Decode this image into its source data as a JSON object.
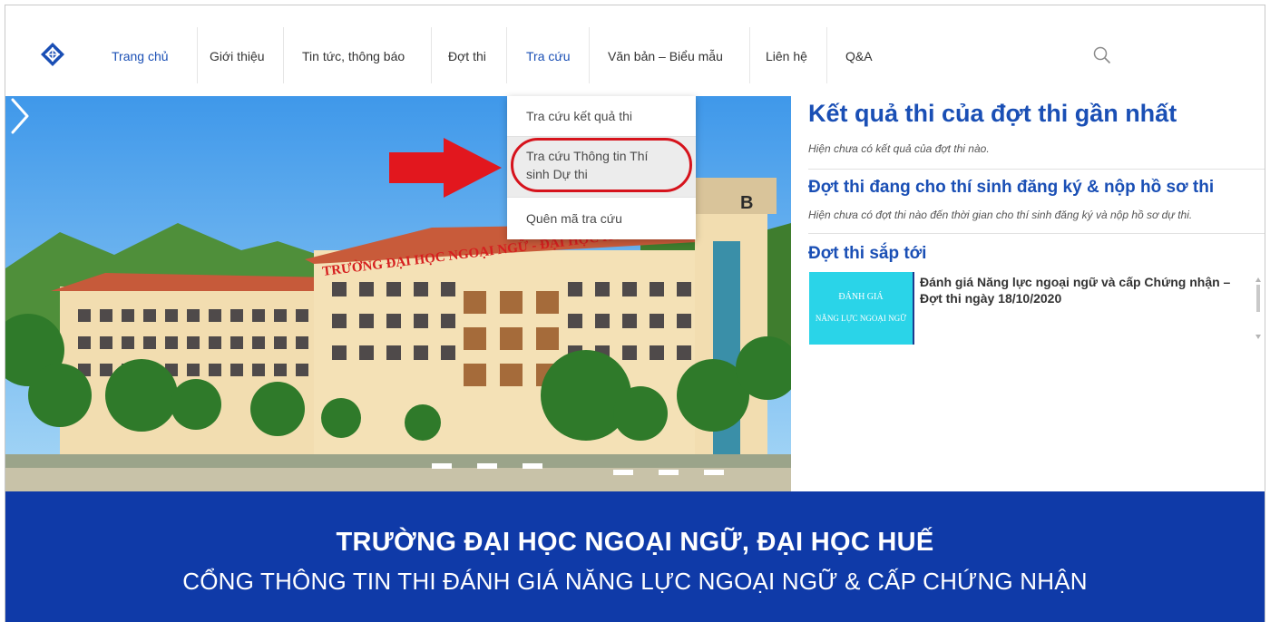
{
  "nav": {
    "items": [
      {
        "label": "Trang chủ",
        "active": true
      },
      {
        "label": "Giới thiệu",
        "active": false
      },
      {
        "label": "Tin tức, thông báo",
        "active": false
      },
      {
        "label": "Đợt thi",
        "active": false
      },
      {
        "label": "Tra cứu",
        "active": true
      },
      {
        "label": "Văn bản – Biểu mẫu",
        "active": false
      },
      {
        "label": "Liên hệ",
        "active": false
      },
      {
        "label": "Q&A",
        "active": false
      }
    ],
    "search_icon": "search-icon"
  },
  "dropdown": {
    "items": [
      {
        "label": "Tra cứu kết quả thi"
      },
      {
        "label_line1": "Tra cứu Thông tin Thí",
        "label_line2": "sinh Dự thi",
        "highlighted": true
      },
      {
        "label": "Quên mã tra cứu"
      }
    ]
  },
  "hero": {
    "building_sign": "TRƯỜNG ĐẠI HỌC NGOẠI NGỮ - ĐẠI HỌC HUẾ",
    "block_letter": "B"
  },
  "panel": {
    "latest_results_title": "Kết quả thi của đợt thi gần nhất",
    "latest_results_note": "Hiện chưa có kết quả của đợt thi nào.",
    "registration_title": "Đợt thi đang cho thí sinh đăng ký & nộp hồ sơ thi",
    "registration_note": "Hiện chưa có đợt thi nào đến thời gian cho thí sinh đăng ký và nộp hồ sơ dự thi.",
    "upcoming_title": "Đợt thi sắp tới",
    "upcoming_event": {
      "thumb_line1": "ĐÁNH GIÁ",
      "thumb_line2": "NĂNG LỰC NGOẠI NGỮ",
      "title": "Đánh giá Năng lực ngoại ngữ và cấp Chứng nhận – Đợt thi ngày 18/10/2020"
    }
  },
  "banner": {
    "line1": "TRƯỜNG ĐẠI HỌC NGOẠI NGỮ, ĐẠI HỌC HUẾ",
    "line2": "CỔNG THÔNG TIN THI ĐÁNH GIÁ NĂNG LỰC NGOẠI NGỮ & CẤP CHỨNG NHẬN"
  },
  "colors": {
    "brand_blue": "#1a4fb5",
    "banner_blue": "#0f3aa8",
    "highlight_red": "#d6131c",
    "thumb_cyan": "#2ad4e8"
  }
}
